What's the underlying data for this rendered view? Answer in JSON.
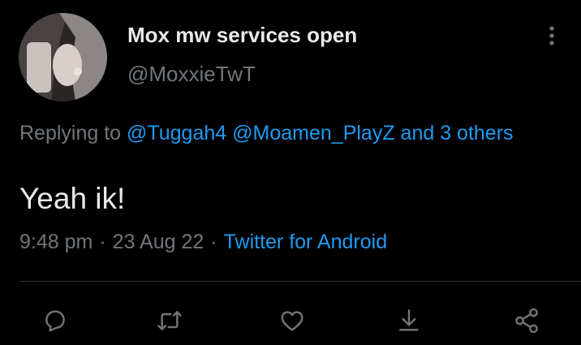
{
  "tweet": {
    "author": {
      "display_name": "Mox mw services open",
      "handle": "@MoxxieTwT"
    },
    "reply_context": {
      "prefix": "Replying to ",
      "mentions": [
        "@Tuggah4",
        "@Moamen_PlayZ"
      ],
      "conjunction": " ",
      "others": "and 3 others"
    },
    "text": "Yeah ik!",
    "time": "9:48 pm",
    "separator": "·",
    "date": "23 Aug 22",
    "source": "Twitter for Android"
  },
  "actions": {
    "icons": [
      "reply-icon",
      "retweet-icon",
      "like-icon",
      "download-icon",
      "share-icon"
    ]
  },
  "colors": {
    "background": "#000000",
    "primary_text": "#e7e9ea",
    "secondary_text": "#71767b",
    "accent": "#1d9bf0",
    "divider": "#2f3336"
  }
}
